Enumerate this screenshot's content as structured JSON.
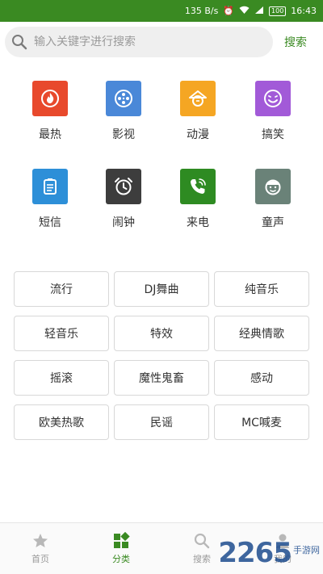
{
  "status_bar": {
    "speed": "135 B/s",
    "battery": "100",
    "time": "16:43"
  },
  "search": {
    "placeholder": "输入关键字进行搜索",
    "button_label": "搜索"
  },
  "categories": [
    {
      "label": "最热",
      "color": "#e8492c",
      "icon": "flame-icon"
    },
    {
      "label": "影视",
      "color": "#4a88d8",
      "icon": "film-reel-icon"
    },
    {
      "label": "动漫",
      "color": "#f5a623",
      "icon": "anime-face-icon"
    },
    {
      "label": "搞笑",
      "color": "#a25ad8",
      "icon": "laugh-face-icon"
    },
    {
      "label": "短信",
      "color": "#2d8fd8",
      "icon": "message-icon"
    },
    {
      "label": "闹钟",
      "color": "#3d3d3d",
      "icon": "alarm-clock-icon"
    },
    {
      "label": "来电",
      "color": "#2e8b22",
      "icon": "phone-call-icon"
    },
    {
      "label": "童声",
      "color": "#6a8278",
      "icon": "child-face-icon"
    }
  ],
  "tags": [
    "流行",
    "DJ舞曲",
    "纯音乐",
    "轻音乐",
    "特效",
    "经典情歌",
    "摇滚",
    "魔性鬼畜",
    "感动",
    "欧美热歌",
    "民谣",
    "MC喊麦"
  ],
  "tabs": [
    {
      "label": "首页",
      "active": false
    },
    {
      "label": "分类",
      "active": true
    },
    {
      "label": "搜索",
      "active": false
    },
    {
      "label": "我的",
      "active": false
    }
  ],
  "watermark": {
    "number": "2265",
    "text": "手游网"
  },
  "colors": {
    "accent": "#3a8a22",
    "status_bar": "#3a8a22",
    "tag_border": "#d8d8d8"
  }
}
